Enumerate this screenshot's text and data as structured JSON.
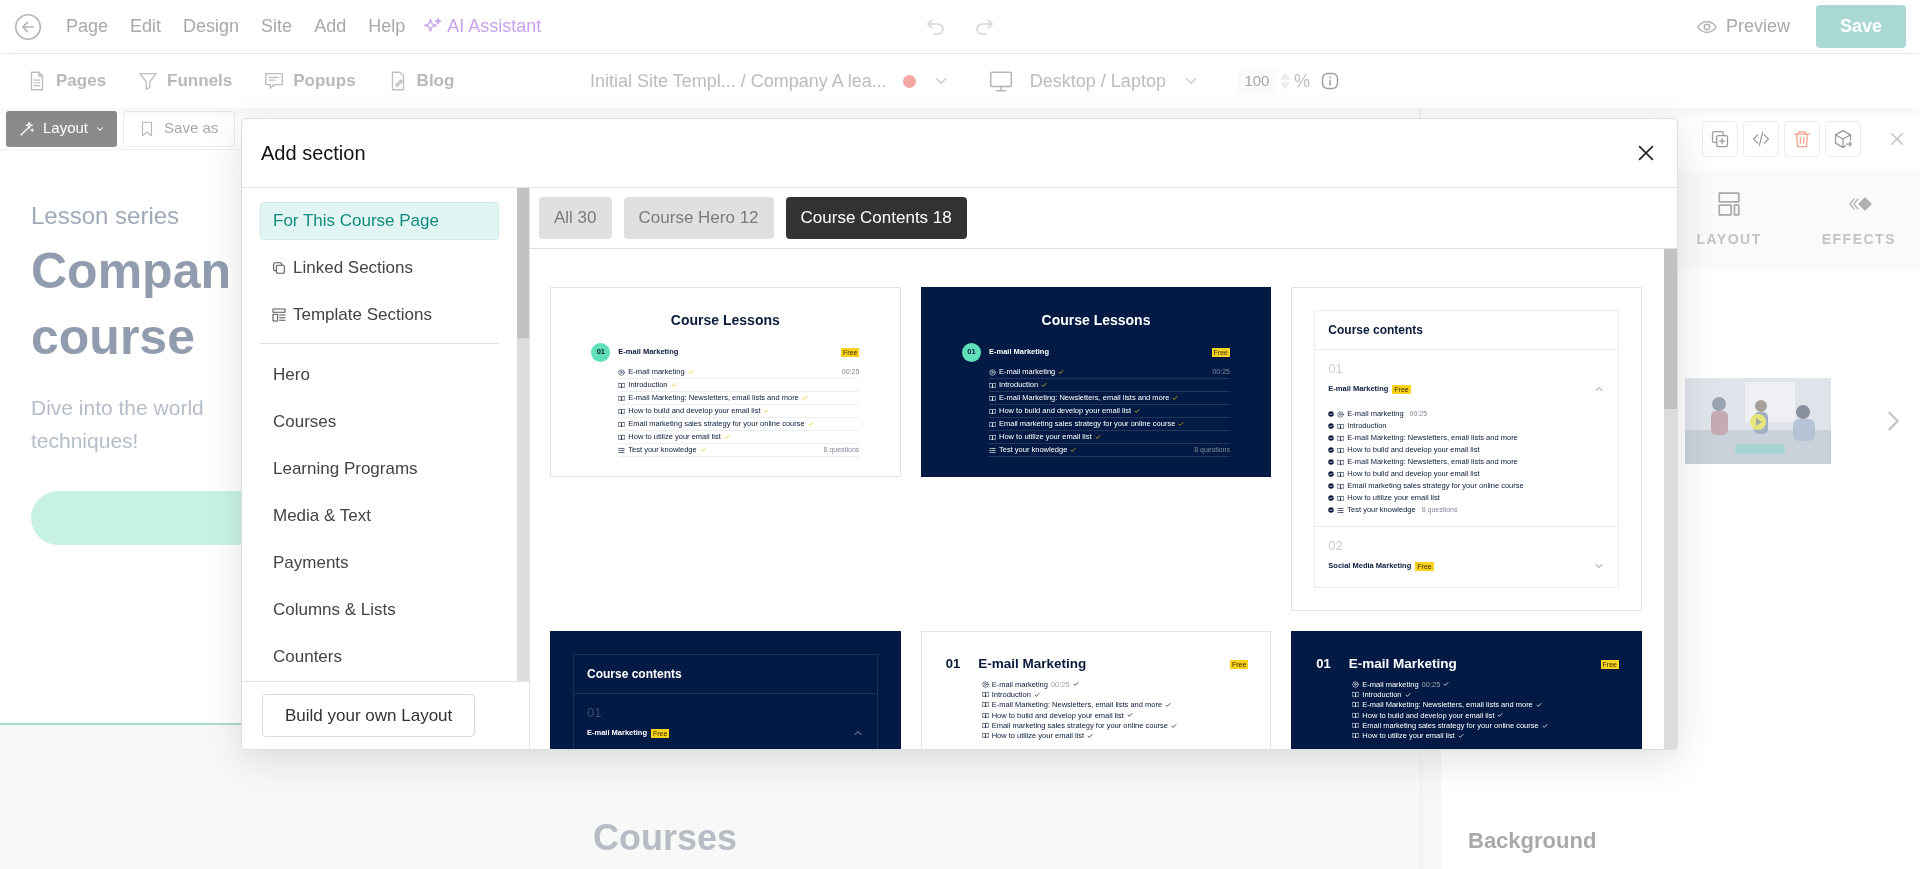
{
  "menu": [
    "Page",
    "Edit",
    "Design",
    "Site",
    "Add",
    "Help"
  ],
  "ai_assistant": "AI Assistant",
  "preview": "Preview",
  "save": "Save",
  "nav": [
    {
      "label": "Pages",
      "kind": "pages"
    },
    {
      "label": "Funnels",
      "kind": "funnels"
    },
    {
      "label": "Popups",
      "kind": "popups"
    },
    {
      "label": "Blog",
      "kind": "blog"
    }
  ],
  "breadcrumb": {
    "text": "Initial Site Templ... / Company A lea...",
    "color": "#f4a7a3"
  },
  "device": "Desktop / Laptop",
  "zoom": {
    "value": "100",
    "unit": "%"
  },
  "toolbar": {
    "layout": "Layout",
    "save_as": "Save as"
  },
  "canvas": {
    "eyebrow": "Lesson series",
    "heading": [
      "Compan",
      "course"
    ],
    "text": [
      "Dive into the world",
      "techniques!"
    ],
    "next_heading": "Courses"
  },
  "panel": {
    "tabs": [
      {
        "label": "LAYOUT",
        "kind": "layout"
      },
      {
        "label": "EFFECTS",
        "kind": "effects"
      }
    ],
    "section_title": "Background"
  },
  "modal": {
    "title": "Add section",
    "categories": [
      {
        "label": "For This Course Page",
        "kind": "pinned",
        "selected": true
      },
      {
        "label": "Linked Sections",
        "kind": "linked",
        "selected": false
      },
      {
        "label": "Template Sections",
        "kind": "template",
        "selected": false
      },
      {
        "label": "Hero",
        "kind": "category",
        "selected": false
      },
      {
        "label": "Courses",
        "kind": "category",
        "selected": false
      },
      {
        "label": "Learning Programs",
        "kind": "category",
        "selected": false
      },
      {
        "label": "Media & Text",
        "kind": "category",
        "selected": false
      },
      {
        "label": "Payments",
        "kind": "category",
        "selected": false
      },
      {
        "label": "Columns & Lists",
        "kind": "category",
        "selected": false
      },
      {
        "label": "Counters",
        "kind": "category",
        "selected": false
      }
    ],
    "footer_button": "Build your own Layout",
    "filters": [
      {
        "label": "All 30",
        "selected": false
      },
      {
        "label": "Course Hero 12",
        "selected": false
      },
      {
        "label": "Course Contents 18",
        "selected": true
      }
    ],
    "templates": [
      {
        "kind": "lessons",
        "dark": false,
        "title": "Course Lessons",
        "modules": [
          {
            "number": "01",
            "title": "E-mail Marketing",
            "tag": "Free",
            "lessons": [
              {
                "kind": "video",
                "text": "E-mail marketing",
                "meta": "00:25",
                "done": true
              },
              {
                "kind": "text",
                "text": "Introduction",
                "done": true
              },
              {
                "kind": "text",
                "text": "E-mail Marketing: Newsletters, email lists and more",
                "done": true
              },
              {
                "kind": "text",
                "text": "How to build and develop your email list",
                "done": true
              },
              {
                "kind": "text",
                "text": "Email marketing sales strategy for your online course",
                "done": true
              },
              {
                "kind": "text",
                "text": "How to utilize your email list",
                "done": true
              },
              {
                "kind": "quiz",
                "text": "Test your knowledge",
                "meta": "8 questions",
                "done": true
              }
            ]
          }
        ]
      },
      {
        "kind": "lessons",
        "dark": true,
        "title": "Course Lessons",
        "modules": [
          {
            "number": "01",
            "title": "E-mail Marketing",
            "tag": "Free",
            "lessons": [
              {
                "kind": "video",
                "text": "E-mail marketing",
                "meta": "00:25",
                "done": true
              },
              {
                "kind": "text",
                "text": "Introduction",
                "done": true
              },
              {
                "kind": "text",
                "text": "E-mail Marketing: Newsletters, email lists and more",
                "done": true
              },
              {
                "kind": "text",
                "text": "How to build and develop your email list",
                "done": true
              },
              {
                "kind": "text",
                "text": "Email marketing sales strategy for your online course",
                "done": true
              },
              {
                "kind": "text",
                "text": "How to utilize your email list",
                "done": true
              },
              {
                "kind": "quiz",
                "text": "Test your knowledge",
                "meta": "8 questions",
                "done": true
              }
            ]
          }
        ]
      },
      {
        "kind": "contents",
        "dark": false,
        "title": "Course contents",
        "modules": [
          {
            "number": "01",
            "title": "E-mail Marketing",
            "tag": "Free",
            "expanded": true,
            "lessons": [
              {
                "kind": "video",
                "text": "E-mail marketing",
                "meta": "00:25",
                "done": true
              },
              {
                "kind": "text",
                "text": "Introduction",
                "done": true
              },
              {
                "kind": "text",
                "text": "E-mail Marketing: Newsletters, email lists and more",
                "done": true
              },
              {
                "kind": "text",
                "text": "How to build and develop your email list",
                "done": true
              },
              {
                "kind": "text",
                "text": "E-mail Marketing: Newsletters, email lists and more",
                "done": true
              },
              {
                "kind": "text",
                "text": "How to build and develop your email list",
                "done": true
              },
              {
                "kind": "text",
                "text": "Email marketing sales strategy for your online course",
                "done": true
              },
              {
                "kind": "text",
                "text": "How to utilize your email list",
                "done": true
              },
              {
                "kind": "quiz",
                "text": "Test your knowledge",
                "meta": "8 questions",
                "done": true
              }
            ]
          },
          {
            "number": "02",
            "title": "Social Media Marketing",
            "tag": "Free",
            "expanded": false
          }
        ]
      },
      {
        "kind": "contents",
        "dark": true,
        "title": "Course contents",
        "modules": [
          {
            "number": "01",
            "title": "E-mail Marketing",
            "tag": "Free",
            "expanded": true
          }
        ]
      },
      {
        "kind": "module",
        "dark": false,
        "modules": [
          {
            "number": "01",
            "title": "E-mail Marketing",
            "tag": "Free",
            "lessons": [
              {
                "kind": "video",
                "text": "E-mail marketing",
                "meta": "00:25",
                "done": true
              },
              {
                "kind": "text",
                "text": "Introduction",
                "done": true
              },
              {
                "kind": "text",
                "text": "E-mail Marketing: Newsletters, email lists and more",
                "done": true
              },
              {
                "kind": "text",
                "text": "How to build and develop your email list",
                "done": true
              },
              {
                "kind": "text",
                "text": "Email marketing sales strategy for your online course",
                "done": true
              },
              {
                "kind": "text",
                "text": "How to utilize your email list",
                "done": true
              }
            ]
          }
        ]
      },
      {
        "kind": "module",
        "dark": true,
        "modules": [
          {
            "number": "01",
            "title": "E-mail Marketing",
            "tag": "Free",
            "lessons": [
              {
                "kind": "video",
                "text": "E-mail marketing",
                "meta": "00:25",
                "done": true
              },
              {
                "kind": "text",
                "text": "Introduction",
                "done": true
              },
              {
                "kind": "text",
                "text": "E-mail Marketing: Newsletters, email lists and more",
                "done": true
              },
              {
                "kind": "text",
                "text": "How to build and develop your email list",
                "done": true
              },
              {
                "kind": "text",
                "text": "Email marketing sales strategy for your online course",
                "done": true
              },
              {
                "kind": "text",
                "text": "How to utilize your email list",
                "done": true
              }
            ]
          }
        ]
      }
    ]
  }
}
